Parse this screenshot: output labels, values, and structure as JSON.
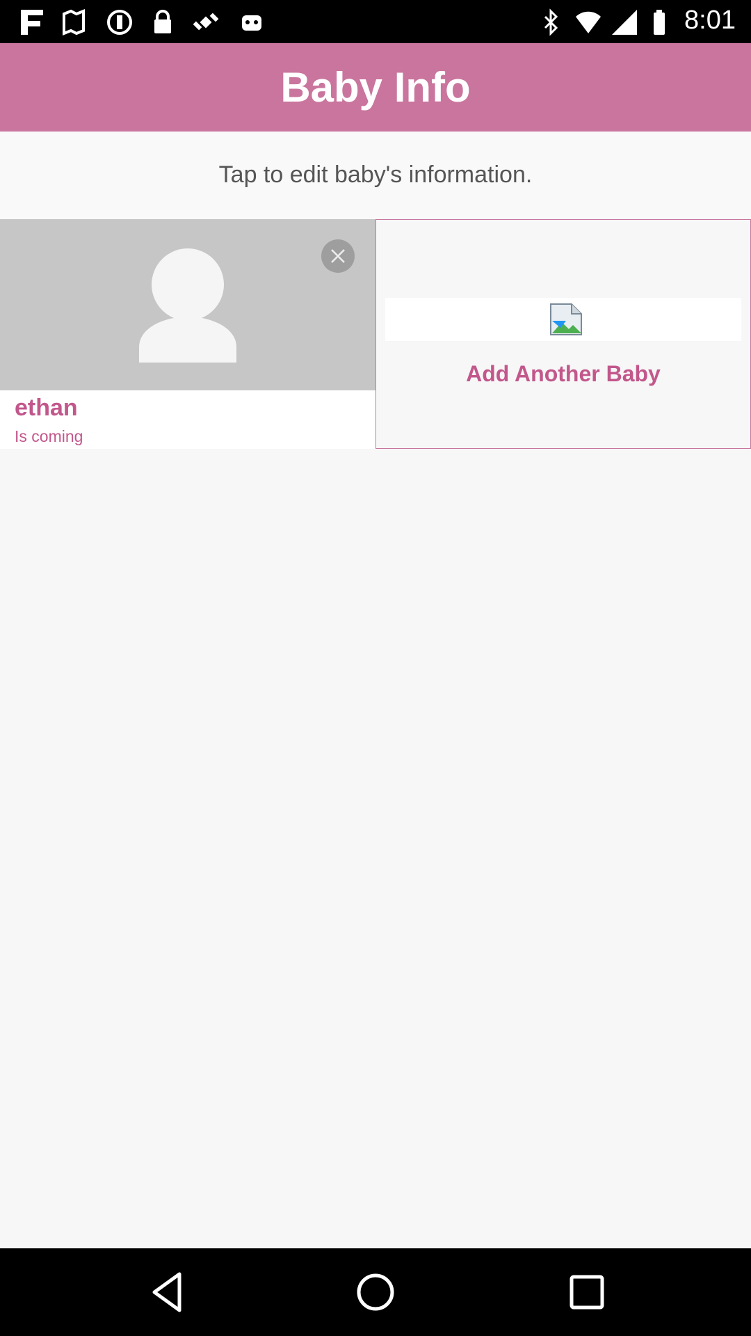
{
  "status_bar": {
    "time": "8:01",
    "left_icons": [
      "app-icon",
      "map-icon",
      "info-icon",
      "lock-icon",
      "satellite-icon",
      "android-icon"
    ],
    "right_icons": [
      "bluetooth-icon",
      "wifi-icon",
      "signal-icon",
      "battery-icon"
    ]
  },
  "header": {
    "title": "Baby Info",
    "color": "#c9759d"
  },
  "hint": "Tap to edit baby's information.",
  "babies": [
    {
      "name": "ethan",
      "status": "Is coming"
    }
  ],
  "add_card": {
    "label": "Add Another Baby"
  },
  "accent_color": "#c2578b",
  "nav_bar": {
    "buttons": [
      "back-icon",
      "home-icon",
      "recents-icon"
    ]
  }
}
